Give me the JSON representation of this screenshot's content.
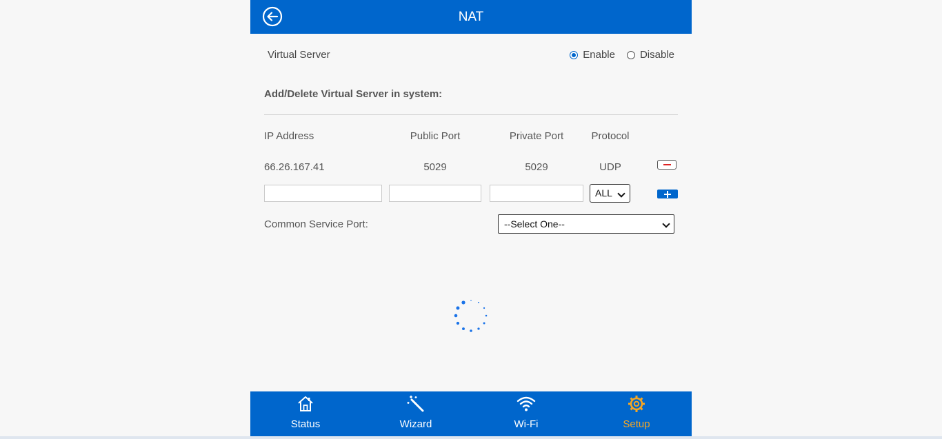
{
  "header": {
    "title": "NAT",
    "back_icon": "back-arrow-circle-icon"
  },
  "virtual_server": {
    "label": "Virtual Server",
    "options": [
      {
        "label": "Enable",
        "checked": true
      },
      {
        "label": "Disable",
        "checked": false
      }
    ]
  },
  "section": {
    "title": "Add/Delete Virtual Server in system:"
  },
  "table": {
    "headers": {
      "ip": "IP Address",
      "public_port": "Public Port",
      "private_port": "Private Port",
      "protocol": "Protocol"
    },
    "rows": [
      {
        "ip": "66.26.167.41",
        "public_port": "5029",
        "private_port": "5029",
        "protocol": "UDP"
      }
    ],
    "new_row": {
      "ip": "",
      "public_port": "",
      "private_port": "",
      "protocol_selected": "ALL"
    }
  },
  "common_service": {
    "label": "Common Service Port:",
    "selected": "--Select One--"
  },
  "nav": {
    "items": [
      {
        "label": "Status",
        "icon": "house-icon",
        "active": false
      },
      {
        "label": "Wizard",
        "icon": "magic-wand-icon",
        "active": false
      },
      {
        "label": "Wi-Fi",
        "icon": "wifi-icon",
        "active": false
      },
      {
        "label": "Setup",
        "icon": "gear-icon",
        "active": true
      }
    ]
  },
  "colors": {
    "primary": "#0066cc",
    "active_nav": "#f5a623",
    "spinner": "#1a73e8"
  }
}
